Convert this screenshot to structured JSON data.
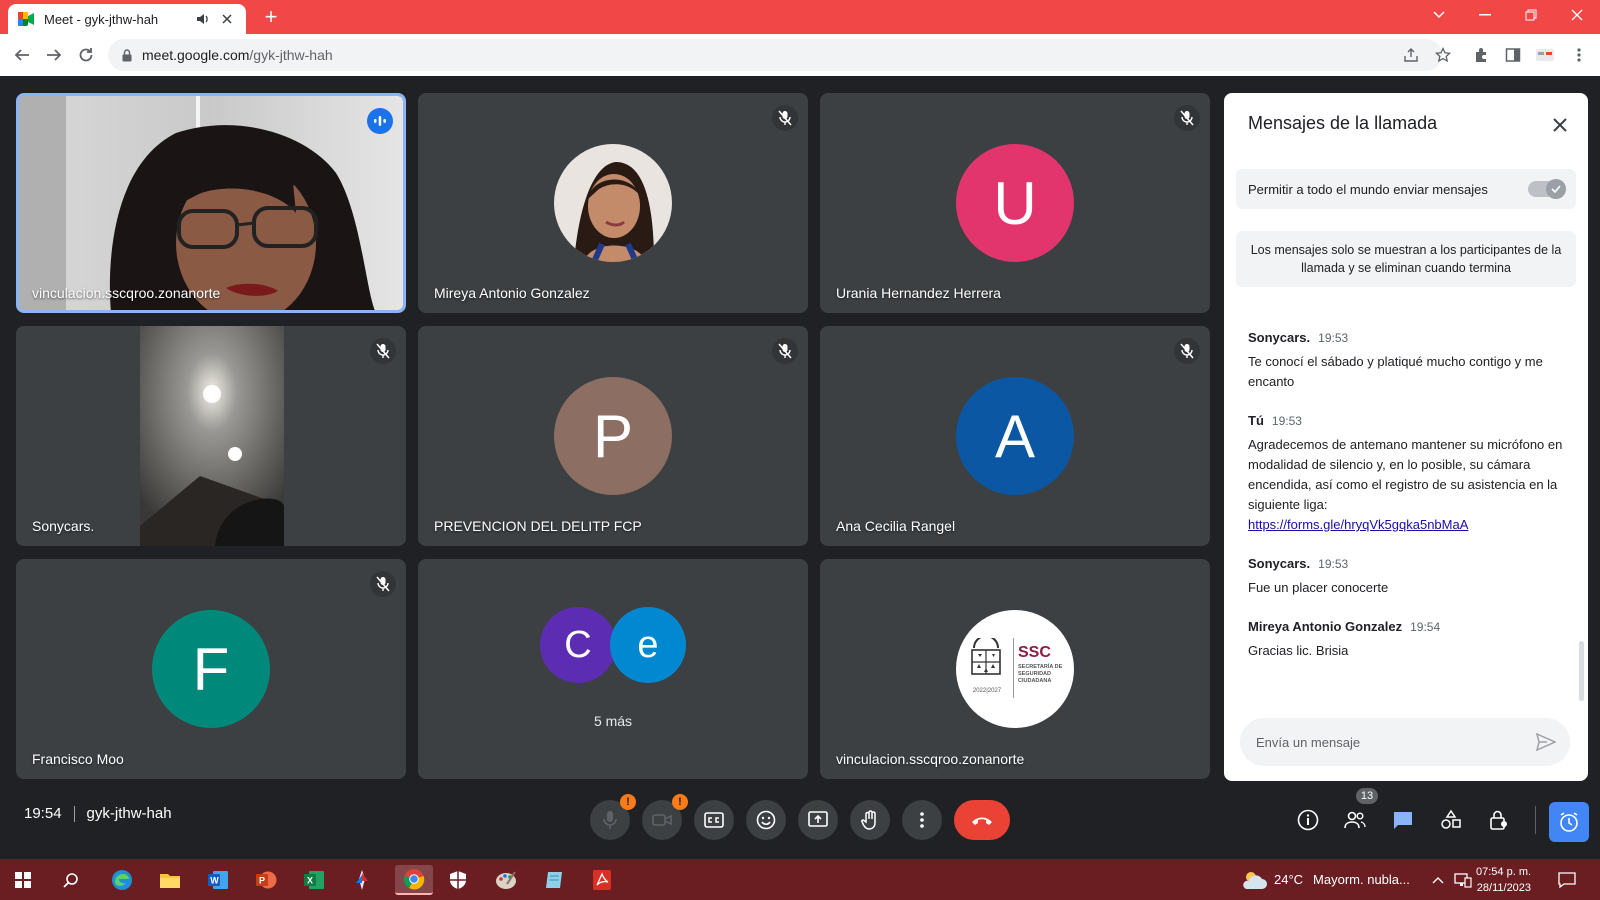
{
  "browser": {
    "tab_title": "Meet - gyk-jthw-hah",
    "url_domain": "meet.google.com",
    "url_path": "/gyk-jthw-hah"
  },
  "tiles": [
    {
      "name": "vinculacion.sscqroo.zonanorte"
    },
    {
      "name": "Mireya Antonio Gonzalez"
    },
    {
      "name": "Urania Hernandez Herrera",
      "initial": "U"
    },
    {
      "name": "Sonycars."
    },
    {
      "name": "PREVENCION DEL DELITP FCP",
      "initial": "P"
    },
    {
      "name": "Ana Cecilia Rangel",
      "initial": "A"
    },
    {
      "name": "Francisco Moo",
      "initial": "F"
    },
    {
      "more_label": "5 más",
      "initial_1": "C",
      "initial_2": "e"
    },
    {
      "name": "vinculacion.sscqroo.zonanorte",
      "logo_text": "SSC",
      "logo_subtext": "SECRETARÍA DE SEGURIDAD CIUDADANA",
      "logo_years": "2022|2027"
    }
  ],
  "colors": {
    "avatar_u": "#e2356e",
    "avatar_p": "#8d6e63",
    "avatar_a": "#0b57a4",
    "avatar_f": "#00897b",
    "avatar_c": "#5c2db3",
    "avatar_e": "#0288d1",
    "accent": "#1a73e8",
    "end_call": "#ea4335",
    "tab_strip": "#f24747",
    "taskbar": "#6b1e22"
  },
  "chat": {
    "title": "Mensajes de la llamada",
    "permission_label": "Permitir a todo el mundo enviar mensajes",
    "info": "Los mensajes solo se muestran a los participantes de la llamada y se eliminan cuando termina",
    "messages": [
      {
        "sender": "Sonycars.",
        "time": "19:53",
        "text": "Te conocí el sábado y platiqué mucho contigo y me encanto"
      },
      {
        "sender": "Tú",
        "time": "19:53",
        "text": "Agradecemos de antemano mantener su micrófono en modalidad de silencio y, en lo posible, su cámara encendida, así como el registro de su asistencia en la siguiente liga:",
        "link": "https://forms.gle/hryqVk5gqka5nbMaA"
      },
      {
        "sender": "Sonycars.",
        "time": "19:53",
        "text": "Fue un placer conocerte"
      },
      {
        "sender": "Mireya Antonio Gonzalez",
        "time": "19:54",
        "text": "Gracias lic. Brisia"
      }
    ],
    "input_placeholder": "Envía un mensaje"
  },
  "meeting": {
    "time": "19:54",
    "code": "gyk-jthw-hah",
    "participants_count": "13"
  },
  "taskbar": {
    "weather_temp": "24°C",
    "weather_text": "Mayorm. nubla...",
    "clock_time": "07:54 p. m.",
    "clock_date": "28/11/2023"
  }
}
